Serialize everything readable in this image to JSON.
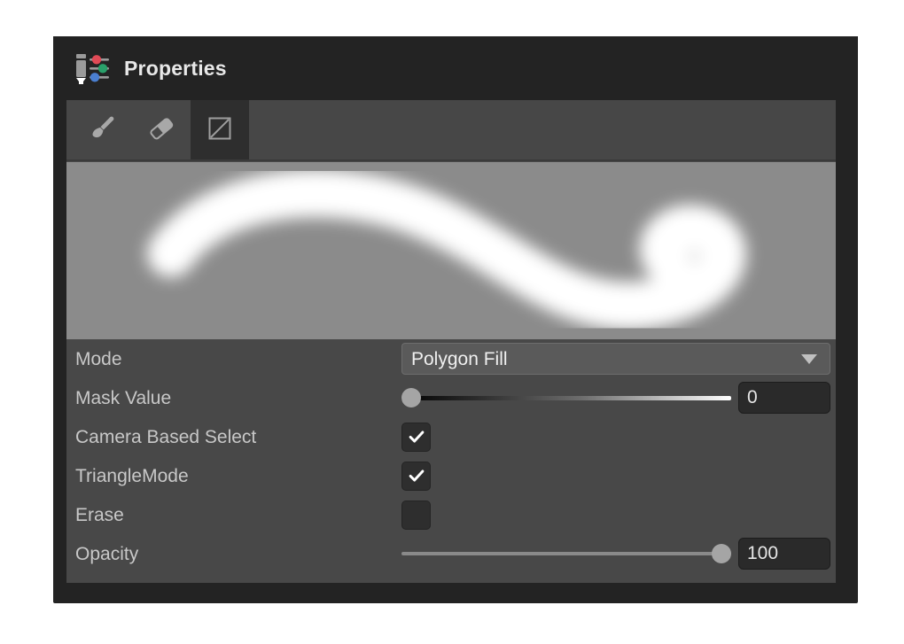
{
  "window": {
    "title": "Properties",
    "title_icon": "pen-sliders-icon"
  },
  "colors": {
    "frame": "#232323",
    "panel": "#484848",
    "toolbar": "#474747",
    "toolbar_selected": "#2e2e2e",
    "preview_background": "#8b8b8b",
    "stroke": "#ffffff",
    "label_text": "#c8c8c8",
    "value_text": "#f0f0f0",
    "field_background": "#2a2a2a",
    "slider_handle": "#a5a5a5",
    "icon_red": "#e04a56",
    "icon_green": "#29a06a",
    "icon_blue": "#4a7fd0"
  },
  "toolbar": {
    "tools": [
      {
        "name": "brush-tool",
        "icon": "brush-icon",
        "selected": false
      },
      {
        "name": "eraser-tool",
        "icon": "eraser-icon",
        "selected": false
      },
      {
        "name": "polygon-fill-tool",
        "icon": "square-diagonal-icon",
        "selected": true
      }
    ]
  },
  "preview": {
    "name": "brush-stroke-preview",
    "description": "soft white S-curve brush stroke on gray background"
  },
  "properties": [
    {
      "label": "Mode",
      "name": "mode",
      "control": "dropdown",
      "value": "Polygon Fill",
      "caret_icon": "chevron-down-icon"
    },
    {
      "label": "Mask Value",
      "name": "mask-value",
      "control": "slider",
      "value": "0",
      "percent": 0,
      "track": "gradient"
    },
    {
      "label": "Camera Based Select",
      "name": "camera-based-select",
      "control": "checkbox",
      "checked": true
    },
    {
      "label": "TriangleMode",
      "name": "triangle-mode",
      "control": "checkbox",
      "checked": true
    },
    {
      "label": "Erase",
      "name": "erase",
      "control": "checkbox",
      "checked": false
    },
    {
      "label": "Opacity",
      "name": "opacity",
      "control": "slider",
      "value": "100",
      "percent": 100,
      "track": "flat"
    }
  ]
}
